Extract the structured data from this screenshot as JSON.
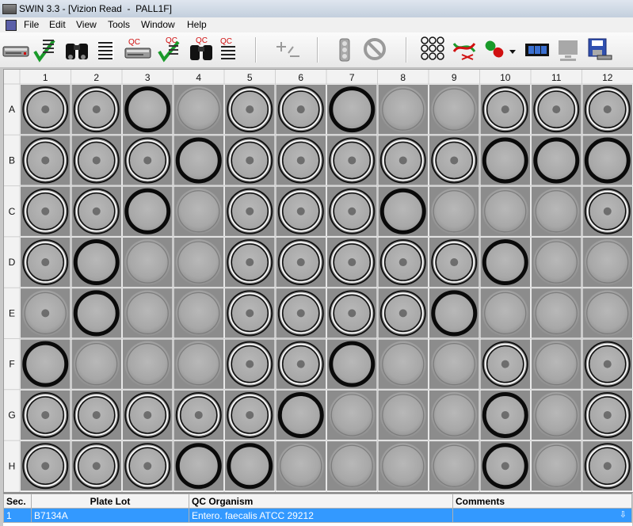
{
  "window": {
    "title": "SWIN 3.3 - [Vizion Read  -  PALL1F]"
  },
  "menu": [
    {
      "label": "File"
    },
    {
      "label": "Edit"
    },
    {
      "label": "View"
    },
    {
      "label": "Tools"
    },
    {
      "label": "Window"
    },
    {
      "label": "Help"
    }
  ],
  "toolbar": {
    "qc_label": "QC",
    "buttons": [
      {
        "name": "scanner-icon"
      },
      {
        "name": "checklist-icon"
      },
      {
        "name": "binoculars-icon"
      },
      {
        "name": "report-icon"
      },
      {
        "name": "qc-scanner-icon"
      },
      {
        "name": "qc-checklist-icon"
      },
      {
        "name": "qc-binoculars-icon"
      },
      {
        "name": "qc-report-icon"
      },
      {
        "name": "plus-minus-icon"
      },
      {
        "name": "dispense-icon"
      },
      {
        "name": "no-entry-icon"
      },
      {
        "name": "well-grid-icon"
      },
      {
        "name": "dna-check-icon"
      },
      {
        "name": "pill-icon"
      },
      {
        "name": "film-strip-icon"
      },
      {
        "name": "monitor-icon"
      },
      {
        "name": "save-icon"
      }
    ]
  },
  "plate": {
    "columns": [
      "1",
      "2",
      "3",
      "4",
      "5",
      "6",
      "7",
      "8",
      "9",
      "10",
      "11",
      "12"
    ],
    "rows": [
      "A",
      "B",
      "C",
      "D",
      "E",
      "F",
      "G",
      "H"
    ],
    "ring_legend": {
      "0": "plain",
      "1": "outlined",
      "2": "heavy"
    },
    "ring_styles": [
      [
        1,
        1,
        2,
        0,
        1,
        1,
        2,
        0,
        0,
        1,
        1,
        1
      ],
      [
        1,
        1,
        1,
        2,
        1,
        1,
        1,
        1,
        1,
        2,
        2,
        2
      ],
      [
        1,
        1,
        2,
        0,
        1,
        1,
        1,
        2,
        0,
        0,
        0,
        1
      ],
      [
        1,
        2,
        0,
        0,
        1,
        1,
        1,
        1,
        1,
        2,
        0,
        0
      ],
      [
        0,
        2,
        0,
        0,
        1,
        1,
        1,
        1,
        2,
        0,
        0,
        0
      ],
      [
        2,
        0,
        0,
        0,
        1,
        1,
        2,
        0,
        0,
        1,
        0,
        1
      ],
      [
        1,
        1,
        1,
        1,
        1,
        2,
        0,
        0,
        0,
        2,
        0,
        1
      ],
      [
        1,
        1,
        1,
        2,
        2,
        0,
        0,
        0,
        0,
        2,
        0,
        1
      ]
    ],
    "button_spots": [
      [
        1,
        1,
        0,
        0,
        1,
        1,
        0,
        0,
        0,
        1,
        1,
        1
      ],
      [
        1,
        1,
        1,
        0,
        1,
        1,
        1,
        1,
        1,
        0,
        0,
        0
      ],
      [
        1,
        1,
        0,
        0,
        1,
        1,
        1,
        0,
        0,
        0,
        0,
        1
      ],
      [
        1,
        0,
        0,
        0,
        1,
        1,
        1,
        1,
        1,
        0,
        0,
        0
      ],
      [
        1,
        0,
        0,
        0,
        1,
        1,
        1,
        1,
        0,
        0,
        0,
        0
      ],
      [
        0,
        0,
        0,
        0,
        1,
        1,
        0,
        0,
        0,
        1,
        0,
        1
      ],
      [
        1,
        1,
        1,
        1,
        1,
        0,
        0,
        0,
        0,
        1,
        0,
        1
      ],
      [
        1,
        1,
        1,
        0,
        0,
        0,
        0,
        0,
        0,
        1,
        0,
        1
      ]
    ]
  },
  "table": {
    "headers": {
      "sec": "Sec.",
      "plate_lot": "Plate Lot",
      "qc_organism": "QC Organism",
      "comments": "Comments"
    },
    "rows": [
      {
        "sec": "1",
        "plate_lot": "B7134A",
        "qc_organism": "Entero. faecalis ATCC 29212",
        "comments": ""
      }
    ],
    "arrow_icon": "down-arrow-icon"
  },
  "colors": {
    "selection": "#3399ff",
    "well_background": "#a9a9a9"
  }
}
